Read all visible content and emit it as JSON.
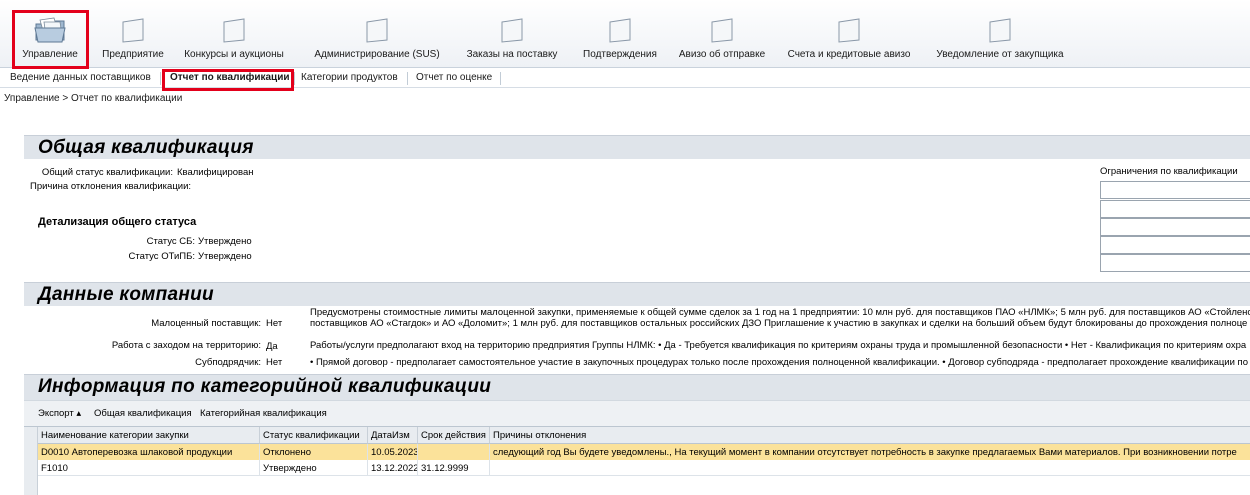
{
  "top_nav": {
    "items": [
      {
        "label": "Управление",
        "icon": "folder-documents-icon"
      },
      {
        "label": "Предприятие",
        "icon": "folder-icon"
      },
      {
        "label": "Конкурсы и аукционы",
        "icon": "folder-icon"
      },
      {
        "label": "Администрирование (SUS)",
        "icon": "folder-icon"
      },
      {
        "label": "Заказы на поставку",
        "icon": "folder-icon"
      },
      {
        "label": "Подтверждения",
        "icon": "folder-icon"
      },
      {
        "label": "Авизо об отправке",
        "icon": "folder-icon"
      },
      {
        "label": "Счета и кредитовые авизо",
        "icon": "folder-icon"
      },
      {
        "label": "Уведомление от закупщика",
        "icon": "folder-icon"
      }
    ],
    "highlight_color": "#e3001b"
  },
  "sub_nav": {
    "tabs": [
      {
        "label": "Ведение данных поставщиков"
      },
      {
        "label": "Отчет по квалификации"
      },
      {
        "label": "Категории продуктов"
      },
      {
        "label": "Отчет по оценке"
      }
    ]
  },
  "breadcrumb": "Управление  >  Отчет по квалификации",
  "general": {
    "title": "Общая квалификация",
    "status_label": "Общий статус квалификации:",
    "status_value": "Квалифицирован",
    "reject_label": "Причина отклонения квалификации:",
    "limits_title": "Ограничения по квалификации",
    "detail_title": "Детализация общего статуса",
    "sb_label": "Статус СБ:",
    "sb_value": "Утверждено",
    "otipb_label": "Статус ОТиПБ:",
    "otipb_value": "Утверждено"
  },
  "company": {
    "title": "Данные компании",
    "small_label": "Малоценный поставщик:",
    "small_value": "Нет",
    "small_text_1": "Предусмотрены стоимостные лимиты малоценной закупки, применяемые к общей сумме сделок за 1 год на 1 предприятии: 10 млн руб. для поставщиков ПАО «НЛМК»; 5 млн руб. для поставщиков АО «Стойленс",
    "small_text_2": "поставщиков АО «Стагдок» и АО «Доломит»; 1 млн руб. для поставщиков остальных российских ДЗО Приглашение к участию в закупках и сделки на больший объем будут блокированы до прохождения полноце",
    "territory_label": "Работа с заходом на территорию:",
    "territory_value": "Да",
    "territory_text": "Работы/услуги предполагают вход на территорию предприятия Группы НЛМК: • Да - Требуется квалификация по критериям охраны труда и промышленной безопасности • Нет - Квалификация по критериям охра",
    "sub_label": "Субподрядчик:",
    "sub_value": "Нет",
    "sub_text": "• Прямой договор - предполагает самостоятельное участие в закупочных процедурах только после прохождения полноценной квалификации. • Договор субподряда - предполагает прохождение квалификации по"
  },
  "category": {
    "title": "Информация по категорийной квалификации",
    "toolbar": {
      "export": "Экспорт",
      "general": "Общая квалификация",
      "categorical": "Категорийная квалификация"
    },
    "columns": [
      "Наименование категории закупки",
      "Статус квалификации",
      "ДатаИзм",
      "Срок действия",
      "Причины отклонения"
    ],
    "rows": [
      {
        "name": "D0010 Автоперевозка шлаковой продукции",
        "status": "Отклонено",
        "date": "10.05.2023",
        "valid": "",
        "reason": "следующий год Вы будете уведомлены., На текущий момент в компании отсутствует потребность в закупке предлагаемых Вами материалов. При возникновении потре",
        "highlight": "#fbe29a"
      },
      {
        "name": "F1010",
        "status": "Утверждено",
        "date": "13.12.2022",
        "valid": "31.12.9999",
        "reason": "",
        "highlight": ""
      }
    ]
  }
}
